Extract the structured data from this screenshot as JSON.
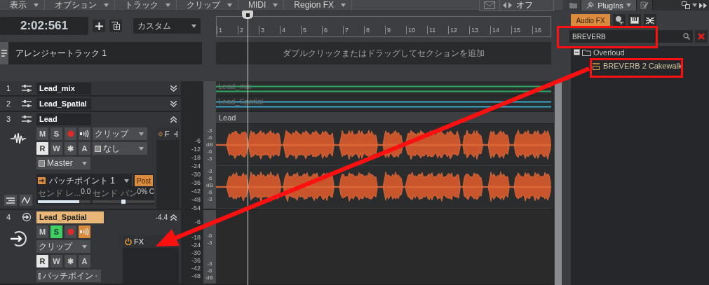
{
  "menu": [
    {
      "label": "表示"
    },
    {
      "label": "オプション"
    },
    {
      "label": "トラック"
    },
    {
      "label": "クリップ"
    },
    {
      "label": "MIDI"
    },
    {
      "label": "Region FX"
    }
  ],
  "snap": {
    "value": "オフ"
  },
  "transport": {
    "time": "2:02:561",
    "workspace": "カスタム"
  },
  "ruler": {
    "marks": [
      "1",
      "2",
      "3",
      "4",
      "5",
      "6",
      "7",
      "8",
      "9",
      "10",
      "11",
      "12",
      "13",
      "14",
      "15",
      "16"
    ]
  },
  "arranger": {
    "track_name": "アレンジャートラック 1",
    "hint": "ダブルクリックまたはドラッグしてセクションを追加"
  },
  "tracks": [
    {
      "number": "1",
      "kind": "collapsed",
      "name": "Lead_mix",
      "selected": false,
      "clip": {
        "label": "Lead_mix",
        "color": "#2fa862"
      }
    },
    {
      "number": "2",
      "kind": "collapsed",
      "name": "Lead_Spatial",
      "selected": false,
      "clip": {
        "label": "Lead_Spatial",
        "color": "#3aa8c8"
      }
    },
    {
      "number": "3",
      "kind": "audio",
      "name": "Lead",
      "selected": false,
      "buttons": [
        {
          "kind": "mute",
          "label": "M",
          "on": false
        },
        {
          "kind": "solo",
          "label": "S",
          "on": false
        },
        {
          "kind": "arm"
        },
        {
          "kind": "echo",
          "on": false
        },
        {
          "kind": "read",
          "label": "R",
          "on": true
        },
        {
          "kind": "write",
          "label": "W",
          "on": false
        },
        {
          "kind": "auto",
          "label": "✱",
          "on": false
        },
        {
          "kind": "automation",
          "label": "A",
          "on": false
        }
      ],
      "input": "クリップ",
      "input_mode": "なし",
      "output": "Master",
      "fx_label": "F",
      "send": {
        "name": "パッチポイント 1",
        "post": {
          "label": "Post",
          "on": true
        },
        "level_label": "センド レ...",
        "level_value": "0.0",
        "level": 0.78,
        "pan_label": "センド パン",
        "pan_value": "0% C",
        "pan_slider": {
          "level": 0.5
        }
      },
      "meter_scale": [
        "-6",
        "-12",
        "-18",
        "-24",
        "-30",
        "-36",
        "-42",
        "-48",
        "-54"
      ],
      "lane_scales": [
        [
          "-3",
          "-6",
          "dB",
          "-6",
          "-3"
        ],
        [
          "-3",
          "-6",
          "dB",
          "-6",
          "-3"
        ]
      ],
      "clip": {
        "label": "Lead",
        "color": "#c8552c"
      }
    },
    {
      "number": "4",
      "kind": "aux",
      "name": "Lead_Spatial",
      "selected": true,
      "volume": "-4.4",
      "buttons": [
        {
          "kind": "mute",
          "label": "M",
          "on": false
        },
        {
          "kind": "solo",
          "label": "S",
          "on": true
        },
        {
          "kind": "arm"
        },
        {
          "kind": "echo",
          "on": true
        },
        {
          "kind": "read",
          "label": "R",
          "on": true
        },
        {
          "kind": "write",
          "label": "W",
          "on": false
        },
        {
          "kind": "auto",
          "label": "✱",
          "on": false
        },
        {
          "kind": "automation",
          "label": "A",
          "on": false
        }
      ],
      "input": "クリップ",
      "output": "パッチポイン",
      "fx_label": "FX",
      "meter_scale": [
        "-6",
        "-18",
        "-24",
        "-30",
        "-36",
        "-42",
        "-48"
      ],
      "lane_scales": [
        [
          "-6",
          "-3"
        ],
        [
          "-3",
          "-6",
          "dB"
        ]
      ]
    }
  ],
  "browser": {
    "tabs": [
      {
        "kind": "folder",
        "selected": false
      },
      {
        "kind": "plugins",
        "label": "PlugIns",
        "selected": true
      },
      {
        "kind": "notes",
        "selected": false
      }
    ],
    "categories": [
      {
        "kind": "text",
        "label": "Audio FX",
        "selected": true
      },
      {
        "kind": "region-fx",
        "selected": false
      },
      {
        "kind": "instruments",
        "selected": false
      },
      {
        "kind": "midi-fx",
        "selected": false
      }
    ],
    "search": {
      "value": "BREVERB"
    },
    "tree": [
      {
        "label": "Overloud",
        "expanded": true,
        "children": [
          {
            "label": "BREVERB 2 Cakewalk"
          }
        ]
      }
    ]
  },
  "annotations": [
    {
      "kind": "search-frame"
    },
    {
      "kind": "item-frame"
    },
    {
      "kind": "arrow"
    }
  ]
}
